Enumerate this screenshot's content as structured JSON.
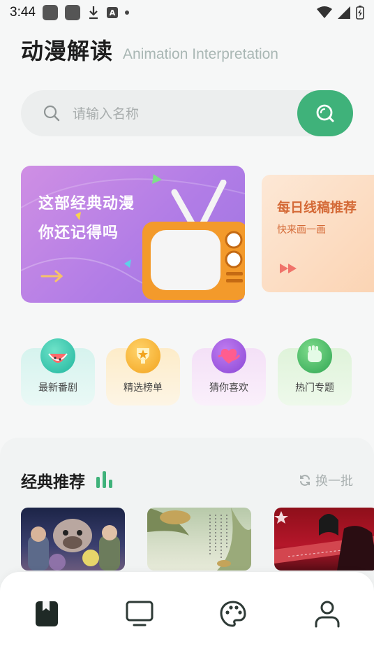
{
  "status_bar": {
    "time": "3:44",
    "letter_icon": "A"
  },
  "header": {
    "title": "动漫解读",
    "subtitle": "Animation Interpretation"
  },
  "search": {
    "placeholder": "请输入名称"
  },
  "banners": [
    {
      "line1": "这部经典动漫",
      "line2": "你还记得吗"
    },
    {
      "title": "每日线稿推荐",
      "subtitle": "快来画一画"
    }
  ],
  "categories": [
    {
      "label": "最新番剧",
      "icon": "watermelon-icon"
    },
    {
      "label": "精选榜单",
      "icon": "trophy-icon"
    },
    {
      "label": "猜你喜欢",
      "icon": "heart-icon"
    },
    {
      "label": "热门专题",
      "icon": "fist-icon"
    }
  ],
  "classic": {
    "title": "经典推荐",
    "refresh_label": "换一批"
  },
  "tabs": [
    {
      "name": "book-icon",
      "active": true
    },
    {
      "name": "tv-icon",
      "active": false
    },
    {
      "name": "palette-icon",
      "active": false
    },
    {
      "name": "profile-icon",
      "active": false
    }
  ],
  "colors": {
    "accent": "#3fb27a",
    "banner_purple": "#b27de6",
    "banner_orange": "#fbd3b2"
  }
}
